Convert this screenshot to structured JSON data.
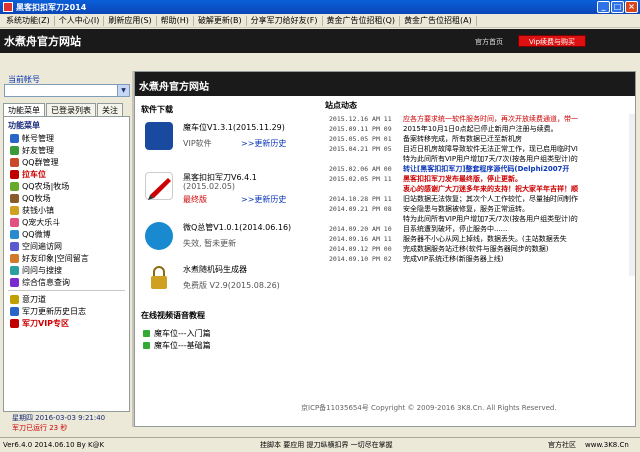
{
  "window": {
    "title": "黑客扣扣军刀2014"
  },
  "menu": [
    "系统功能(Z)",
    "个人中心(I)",
    "刷新应用(S)",
    "帮助(H)",
    "破解更新(B)",
    "分享军刀给好友(F)",
    "黄金广告位招租(Q)",
    "黄金广告位招租(A)"
  ],
  "banner": {
    "site_title": "水煮舟官方网站",
    "home_link": "官方首页",
    "vip_button": "Vip续费与购买"
  },
  "sidebar": {
    "account_label": "当前帐号",
    "tabs": [
      "功能菜单",
      "已登录列表",
      "关注"
    ],
    "section_title": "功能菜单",
    "items": [
      {
        "label": "帐号管理",
        "icon": "account-icon",
        "color": "#2a64c8"
      },
      {
        "label": "好友管理",
        "icon": "friends-icon",
        "color": "#3a9a3a"
      },
      {
        "label": "QQ群管理",
        "icon": "group-icon",
        "color": "#c84a2a"
      },
      {
        "label": "拉车位",
        "icon": "car-icon",
        "color": "#c00000",
        "highlight": true
      },
      {
        "label": "QQ农场|牧场",
        "icon": "farm-icon",
        "color": "#6aaa2a"
      },
      {
        "label": "QQ牧场",
        "icon": "ranch-icon",
        "color": "#8a5a2a"
      },
      {
        "label": "获钱小镇",
        "icon": "town-icon",
        "color": "#d0a020"
      },
      {
        "label": "Q宠大乐斗",
        "icon": "pet-icon",
        "color": "#e05080"
      },
      {
        "label": "QQ微博",
        "icon": "weibo-icon",
        "color": "#2a8ad0"
      },
      {
        "label": "空间遍访网",
        "icon": "space-icon",
        "color": "#5a5ad0"
      },
      {
        "label": "好友印象|空间留言",
        "icon": "impression-icon",
        "color": "#d07a2a"
      },
      {
        "label": "问问与搜搜",
        "icon": "ask-icon",
        "color": "#2aa0a0"
      },
      {
        "label": "综合信息查询",
        "icon": "info-icon",
        "color": "#7a2ad0"
      }
    ],
    "extra_items": [
      {
        "label": "意刀道",
        "icon": "blade-icon",
        "color": "#c0a000"
      },
      {
        "label": "军刀更新历史日志",
        "icon": "log-icon",
        "color": "#2a64c8"
      },
      {
        "label": "军刀VIP专区",
        "icon": "vip-icon",
        "color": "#c00000",
        "highlight": true
      }
    ],
    "status_date": "星期四 2016-03-03 9:21:40",
    "status_running": "军刀已运行 23 秒"
  },
  "main": {
    "header": "水煮舟官方网站",
    "downloads_title": "软件下载",
    "downloads": [
      {
        "name": "魔车位V1.3.1(2015.11.29)",
        "sub": "VIP软件",
        "tag": "",
        "history": ">>更新历史",
        "icon": "car-app-icon",
        "color": "#1a4aa0"
      },
      {
        "name": "黑客扣扣军刀V6.4.1",
        "sub2": "(2015.02.05)",
        "sub": "",
        "tag": "最终版",
        "history": ">>更新历史",
        "icon": "knife-app-icon",
        "color": "#c00000"
      },
      {
        "name": "微Q总管V1.0.1(2014.06.16)",
        "sub": "失效, 暂未更新",
        "tag": "",
        "history": "",
        "icon": "qq-app-icon",
        "color": "#1a8ad0"
      },
      {
        "name": "水煮随机码生成器",
        "sub": "免费版 V2.9(2015.08.26)",
        "tag": "",
        "history": "",
        "icon": "lock-app-icon",
        "color": "#d0a020"
      }
    ],
    "tutorials_title": "在线视频语音教程",
    "tutorials": [
      "魔车位---入门篇",
      "魔车位---基础篇"
    ],
    "news_title": "站点动态",
    "news": [
      {
        "time": "2015.12.16 AM 11",
        "text": "应各方要求统一软件服务时间，再次开放续费通道，带一",
        "style": "red"
      },
      {
        "time": "2015.09.11 PM 09",
        "text": "2015年10月1日0点起已停止新用户注册与续费。",
        "style": ""
      },
      {
        "time": "2015.05.05 PM 01",
        "text": "备案转移完成，所有数据已迁至新机房",
        "style": ""
      },
      {
        "time": "2015.04.21 PM 05",
        "text": "目近日机房故障导致软件无法正常工作，现已启用临时VI",
        "style": ""
      },
      {
        "time": "",
        "text": "特为此间所有VIP用户增加7天/7次(按各用户组类型计)的",
        "style": ""
      },
      {
        "time": "2015.02.06 AM 00",
        "text": "转让[黑客扣扣军刀]整套程序源代码(Delphi2007开",
        "style": "blue bold"
      },
      {
        "time": "2015.02.05 PM 11",
        "text": "黑客扣扣军刀发布最终版，停止更新。",
        "style": "red bold"
      },
      {
        "time": "",
        "text": "衷心的感谢广大刀迷多年来的支持！祝大家羊年吉祥！顺",
        "style": "red bold"
      },
      {
        "time": "2014.10.28 PM 11",
        "text": "旧站数据无法恢复；其次个人工作较忙，尽量抽时间制作",
        "style": ""
      },
      {
        "time": "2014.09.21 PM 08",
        "text": "安全隐患与数据被修复，服务正常运转。",
        "style": ""
      },
      {
        "time": "",
        "text": "特为此间所有VIP用户增加7天/7次(按各用户组类型计)的",
        "style": ""
      },
      {
        "time": "2014.09.20 AM 10",
        "text": "目系统遭到破坏，停止服务中......",
        "style": ""
      },
      {
        "time": "2014.09.16 AM 11",
        "text": "服务器不小心从网上掉线，数据丢失。(主站数据丢失",
        "style": ""
      },
      {
        "time": "2014.09.12 PM 00",
        "text": "完成数据服务站迁移(软件与服务器同步的数据)",
        "style": ""
      },
      {
        "time": "2014.09.10 PM 02",
        "text": "完成VIP系统迁移(新服务器上线)",
        "style": ""
      }
    ],
    "copyright": "京ICP备11035654号 Copyright © 2009-2016 3K8.Cn. All Rights Reserved."
  },
  "statusbar": {
    "version": "Ver6.4.0 2014.06.10 By K@K",
    "center": "挂脚本 要应用 提刀纵横扣界 一切尽在掌握",
    "community": "官方社区",
    "url": "www.3K8.Cn"
  }
}
